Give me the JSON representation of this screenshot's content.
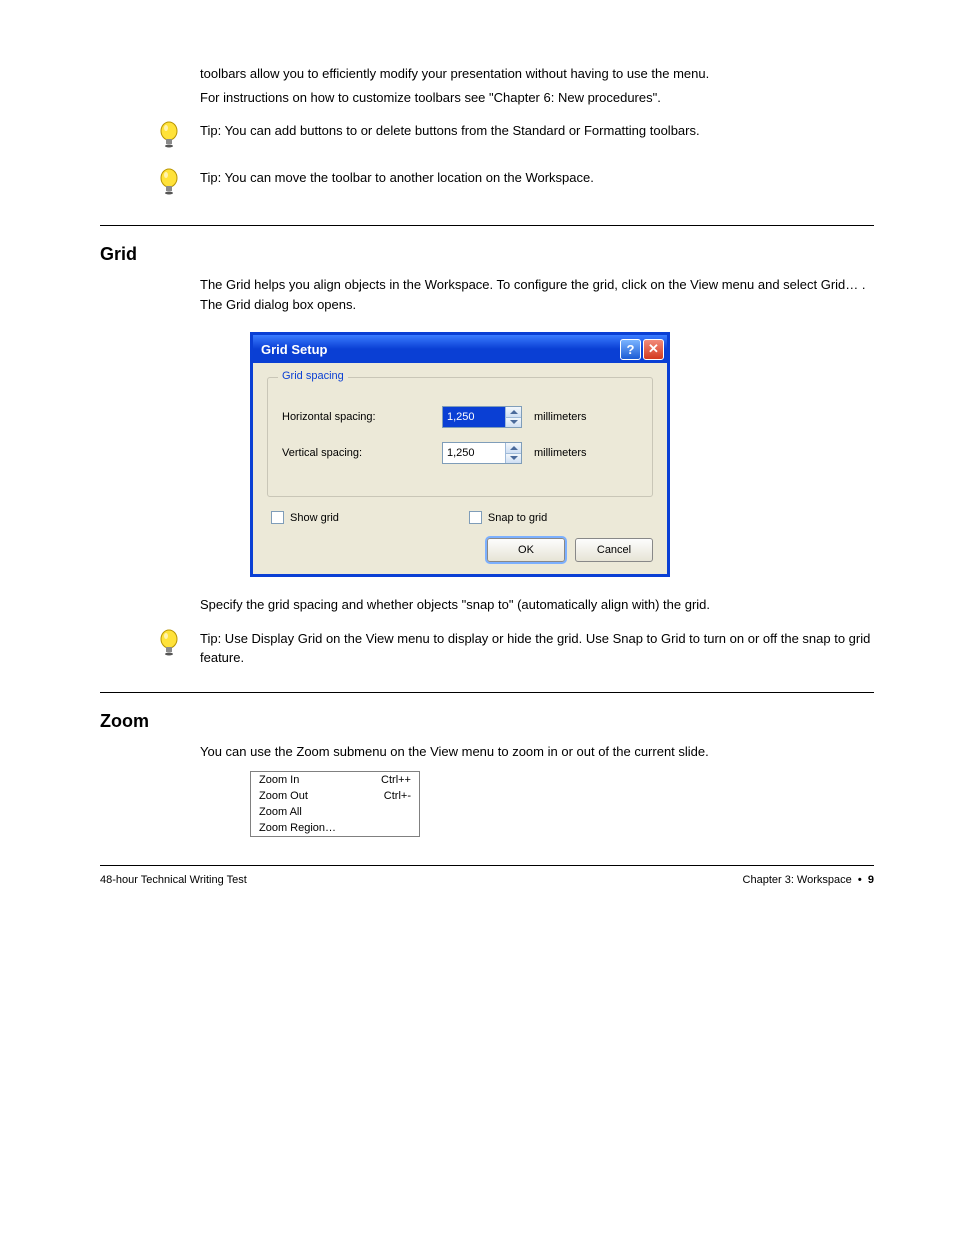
{
  "intro": {
    "p1": "toolbars allow you to efficiently modify your presentation without having to use the menu.",
    "p2": "For instructions on how to customize toolbars see \"Chapter 6: New procedures\"."
  },
  "tips": [
    "Tip: You can add buttons to or delete buttons from the Standard or Formatting toolbars.",
    "Tip: You can move the toolbar to another location on the Workspace."
  ],
  "grid_section": {
    "title": "Grid",
    "p1": "The Grid helps you align objects in the Workspace. To configure the grid, click on the View menu and select Grid… . The Grid dialog box opens.",
    "p2": "Specify the grid spacing and whether objects \"snap to\" (automatically align with) the grid."
  },
  "dialog": {
    "title": "Grid Setup",
    "group_label": "Grid spacing",
    "horizontal_label": "Horizontal spacing:",
    "vertical_label": "Vertical spacing:",
    "horizontal_value": "1,250",
    "vertical_value": "1,250",
    "unit": "millimeters",
    "show_grid": "Show grid",
    "snap_to_grid": "Snap to grid",
    "ok": "OK",
    "cancel": "Cancel",
    "help_symbol": "?",
    "close_symbol": "✕"
  },
  "grid_tip": "Tip: Use Display Grid on the View menu to display or hide the grid. Use Snap to Grid to turn on or off the snap to grid feature.",
  "zoom_section": {
    "title": "Zoom",
    "p1": "You can use the Zoom submenu on the View menu to zoom in or out of the current slide."
  },
  "menu": {
    "items": [
      {
        "label": "Zoom In",
        "shortcut": "Ctrl++"
      },
      {
        "label": "Zoom Out",
        "shortcut": "Ctrl+-"
      },
      {
        "label": "Zoom All",
        "shortcut": ""
      },
      {
        "label": "Zoom Region…",
        "shortcut": ""
      }
    ]
  },
  "footer": {
    "left": "48-hour Technical Writing Test",
    "right_label": "Chapter 3: Workspace",
    "right_sep": "•",
    "right_page": "9"
  }
}
